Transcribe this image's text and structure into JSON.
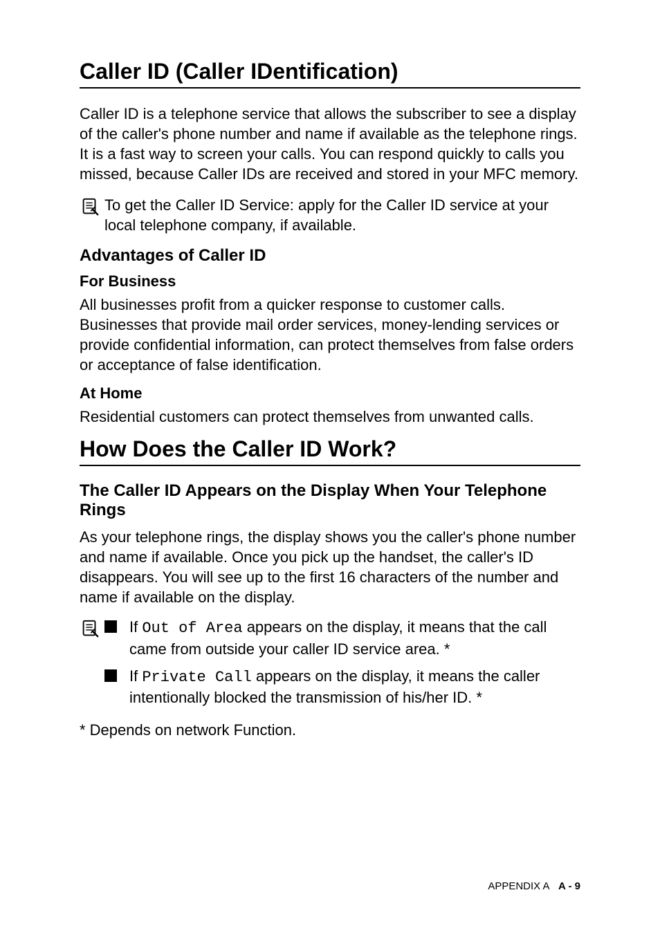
{
  "s1": {
    "title": "Caller ID (Caller IDentification)",
    "intro": "Caller ID is a telephone service that allows the subscriber to see a display of the caller's phone number and name if available as the telephone rings. It is a fast way to screen your calls. You can respond quickly to calls you missed, because Caller IDs are received and stored in your MFC memory.",
    "note": "To get the Caller ID Service: apply for the Caller ID service at your local telephone company, if available.",
    "advantages_title": "Advantages of Caller ID",
    "biz_title": "For Business",
    "biz_text": "All businesses profit from a quicker response to customer calls. Businesses that provide mail order services, money-lending services or provide confidential information, can protect themselves from false orders or acceptance of false identification.",
    "home_title": "At Home",
    "home_text": "Residential customers can protect themselves from unwanted calls."
  },
  "s2": {
    "title": "How Does the Caller ID Work?",
    "sub_title": "The Caller ID Appears on the Display When Your Telephone Rings",
    "desc": "As your telephone rings, the display shows you the caller's phone number and name if available. Once you pick up the handset, the caller's ID disappears. You will see up to the first 16 characters of the number and name if available on the display.",
    "b1_pre": "If ",
    "b1_mono": "Out of Area",
    "b1_post": " appears on the display, it means that the call came from outside your caller ID service area. *",
    "b2_pre": "If ",
    "b2_mono": "Private Call",
    "b2_post": " appears on the display, it means the caller intentionally blocked the transmission of his/her ID. *",
    "footnote": "* Depends on network Function."
  },
  "footer": {
    "label": "APPENDIX A",
    "page": "A - 9"
  }
}
